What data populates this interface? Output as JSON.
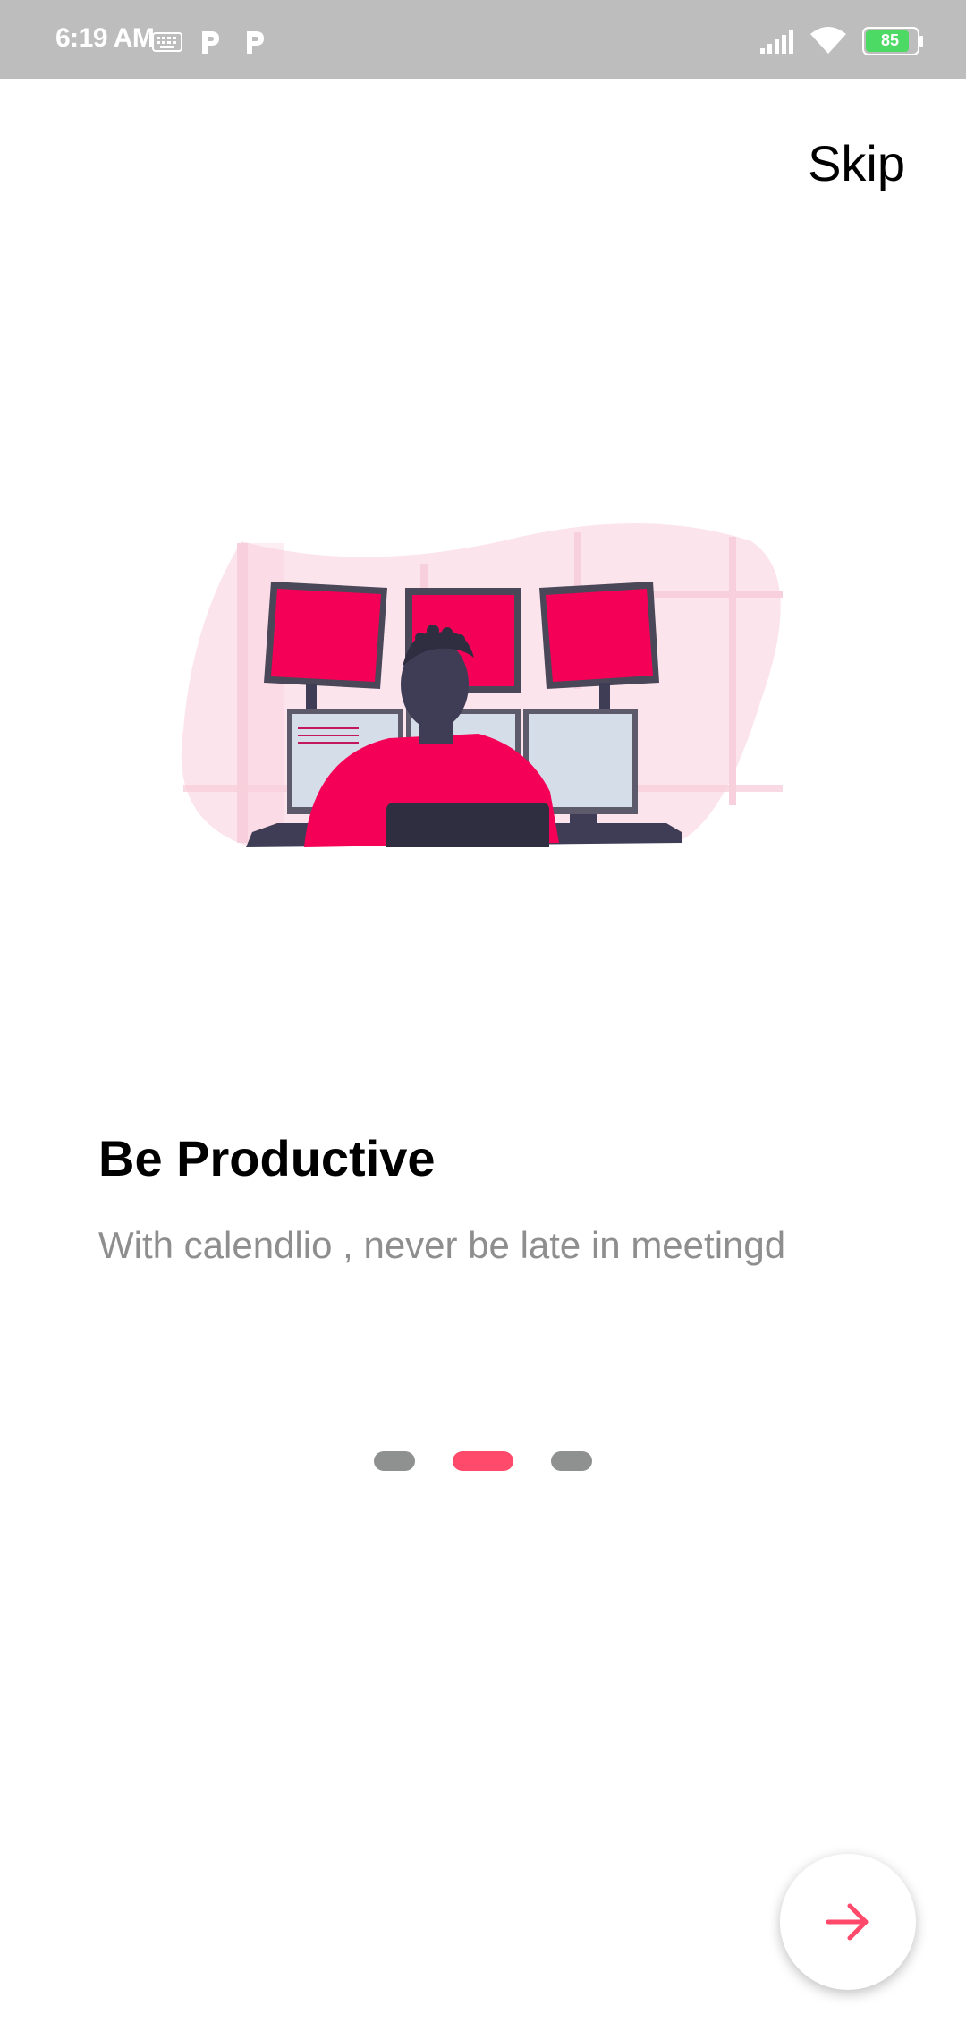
{
  "status_bar": {
    "time": "6:19 AM",
    "battery": "85",
    "icons": [
      "keyboard-icon",
      "parking-icon",
      "parking-icon",
      "signal-icon",
      "wifi-icon",
      "battery-icon"
    ]
  },
  "onboarding": {
    "skip_label": "Skip",
    "title": "Be Productive",
    "subtitle": "With calendlio , never be late in meetingd",
    "pages": 3,
    "current_page": 2,
    "next_icon": "arrow-right-icon"
  },
  "colors": {
    "accent": "#ff4a6b",
    "illustration_red": "#f50057",
    "indicator_inactive": "#8f9090",
    "status_bar": "#bdbdbd"
  }
}
